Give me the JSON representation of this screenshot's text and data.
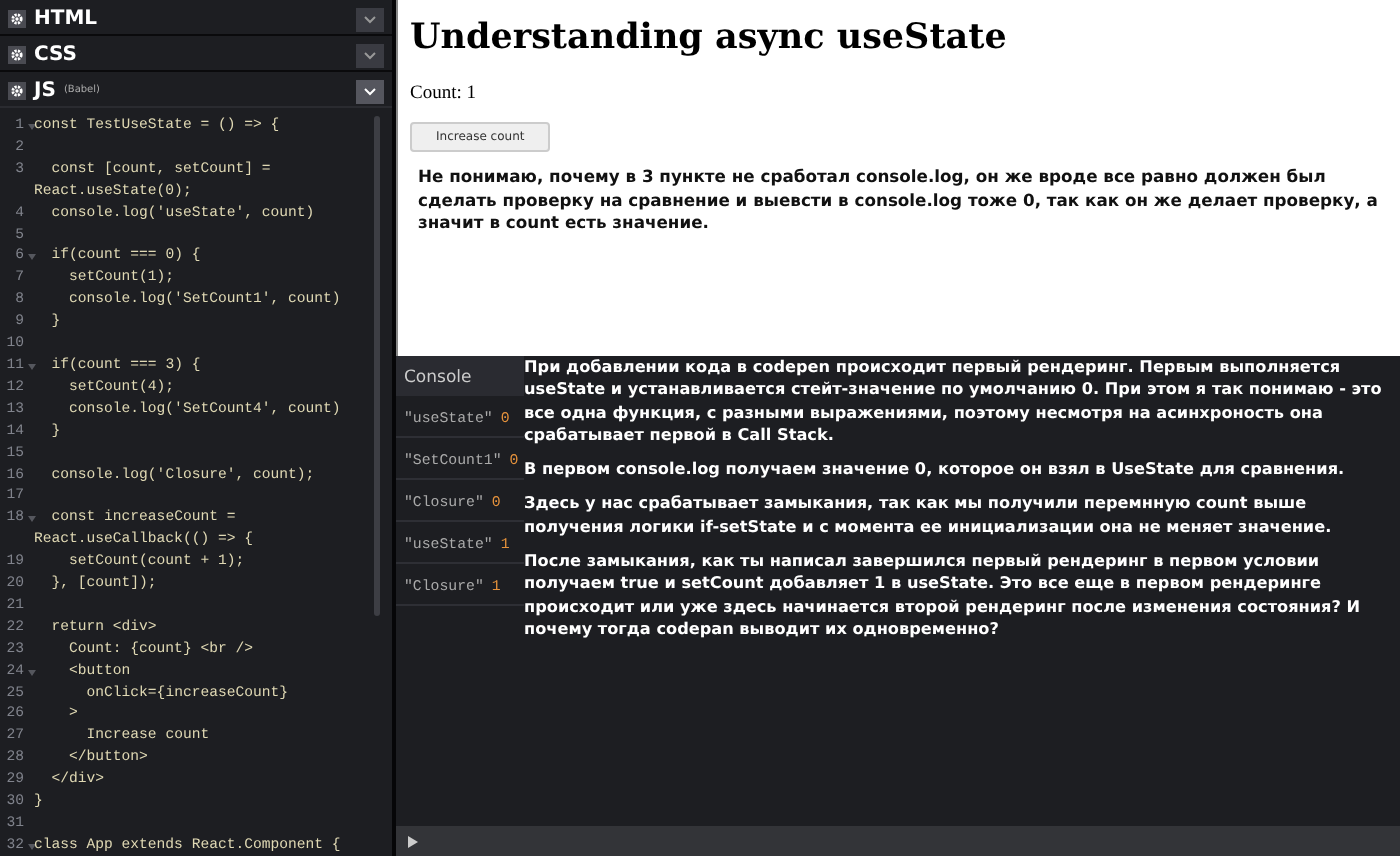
{
  "editor_panels": [
    {
      "title": "HTML",
      "expanded": false
    },
    {
      "title": "CSS",
      "expanded": false
    },
    {
      "title": "JS",
      "subtitle": "(Babel)",
      "expanded": true
    }
  ],
  "code_lines": [
    {
      "number": "1",
      "text": "const TestUseState = () => {",
      "foldable": true
    },
    {
      "number": "2",
      "foldable": false
    },
    {
      "number": "3",
      "text": "  const [count, setCount] = React.useState(0);",
      "foldable": false
    },
    {
      "number": "4",
      "text": "  console.log('useState', count)",
      "foldable": false
    },
    {
      "number": "5",
      "foldable": false
    },
    {
      "number": "6",
      "text": "  if(count === 0) {",
      "foldable": true
    },
    {
      "number": "7",
      "text": "    setCount(1);",
      "foldable": false
    },
    {
      "number": "8",
      "text": "    console.log('SetCount1', count)",
      "foldable": false
    },
    {
      "number": "9",
      "text": "  }",
      "foldable": false
    },
    {
      "number": "10",
      "foldable": false
    },
    {
      "number": "11",
      "text": "  if(count === 3) {",
      "foldable": true
    },
    {
      "number": "12",
      "text": "    setCount(4);",
      "foldable": false
    },
    {
      "number": "13",
      "text": "    console.log('SetCount4', count)",
      "foldable": false
    },
    {
      "number": "14",
      "text": "  }",
      "foldable": false
    },
    {
      "number": "15",
      "foldable": false
    },
    {
      "number": "16",
      "text": "  console.log('Closure', count);",
      "foldable": false
    },
    {
      "number": "17",
      "foldable": false
    },
    {
      "number": "18",
      "text": "  const increaseCount = React.useCallback(() => {",
      "foldable": true
    },
    {
      "number": "19",
      "text": "    setCount(count + 1);",
      "foldable": false
    },
    {
      "number": "20",
      "text": "  }, [count]);",
      "foldable": false
    },
    {
      "number": "21",
      "foldable": false
    },
    {
      "number": "22",
      "text": "  return <div>",
      "foldable": false
    },
    {
      "number": "23",
      "text": "    Count: {count} <br />",
      "foldable": false
    },
    {
      "number": "24",
      "text": "    <button",
      "foldable": true
    },
    {
      "number": "25",
      "text": "      onClick={increaseCount}",
      "foldable": false
    },
    {
      "number": "26",
      "text": "    >",
      "foldable": false
    },
    {
      "number": "27",
      "text": "      Increase count",
      "foldable": false
    },
    {
      "number": "28",
      "text": "    </button>",
      "foldable": false
    },
    {
      "number": "29",
      "text": "  </div>",
      "foldable": false
    },
    {
      "number": "30",
      "text": "}",
      "foldable": false
    },
    {
      "number": "31",
      "foldable": false
    },
    {
      "number": "32",
      "text": "class App extends React.Component {",
      "foldable": true
    }
  ],
  "preview": {
    "heading": "Understanding async useState",
    "count_text": "Count: 1",
    "button": "Increase count",
    "note": "Не понимаю, почему в 3 пункте  не сработал console.log, он же вроде все равно должен был сделать проверку на сравнение и выевсти в console.log тоже 0, так как он же делает проверку, а значит в count есть значение."
  },
  "console": {
    "title": "Console",
    "entries": [
      {
        "label": "\"useState\"",
        "value": "0"
      },
      {
        "label": "\"SetCount1\"",
        "value": "0"
      },
      {
        "label": "\"Closure\"",
        "value": "0"
      },
      {
        "label": "\"useState\"",
        "value": "1"
      },
      {
        "label": "\"Closure\"",
        "value": "1"
      }
    ],
    "annotations": [
      "При добавлении кода в codepen происходит первый рендеринг. Первым выполняется  useState и устанавливается стейт-значение по умолчанию 0. При этом я так понимаю - это все одна функция, с разными выражениями, поэтому несмотря на асинхроность она срабатывает первой в Call Stack.",
      "В первом console.log получаем значение 0, которое он взял в UseState для  сравнения.",
      "Здесь у нас срабатывает замыкания, так как мы получили перемнную count выше получения логики if-setState и с момента ее инициализации она не меняет значение.",
      "После замыкания, как ты написал завершился первый рендеринг в первом условии получаем true и setCount добавляет 1 в useState. Это все еще в первом рендеринге происходит или уже здесь начинается второй рендеринг после изменения состояния? И почему тогда codepan выводит их одновременно?"
    ]
  }
}
